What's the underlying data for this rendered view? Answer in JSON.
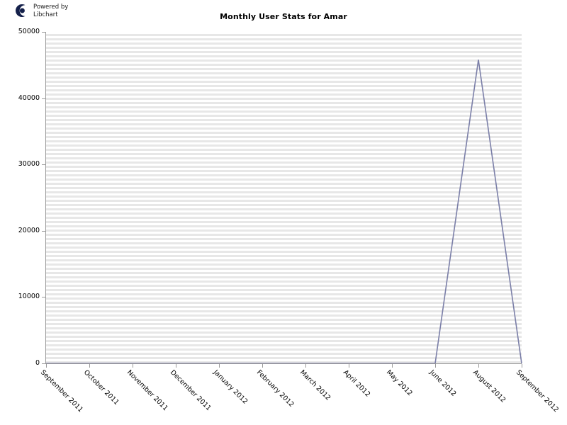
{
  "branding": {
    "logo_icon": "libchart-crescent-logo-icon",
    "line1": "Powered by",
    "line2": "Libchart",
    "logo_color": "#14204a"
  },
  "chart_data": {
    "type": "line",
    "title": "Monthly User Stats for Amar",
    "xlabel": "",
    "ylabel": "",
    "categories": [
      "September 2011",
      "October 2011",
      "November 2011",
      "December 2011",
      "January 2012",
      "February 2012",
      "March 2012",
      "April 2012",
      "May 2012",
      "June 2012",
      "August 2012",
      "September 2012"
    ],
    "values": [
      0,
      0,
      0,
      0,
      0,
      0,
      0,
      0,
      0,
      0,
      45800,
      0
    ],
    "series": [
      {
        "name": "Monthly User Stats for Amar",
        "values": [
          0,
          0,
          0,
          0,
          0,
          0,
          0,
          0,
          0,
          0,
          45800,
          0
        ]
      }
    ],
    "ylim": [
      0,
      50000
    ],
    "yticks": [
      0,
      10000,
      20000,
      30000,
      40000,
      50000
    ],
    "ytick_labels": [
      "0",
      "10000",
      "20000",
      "30000",
      "40000",
      "50000"
    ],
    "grid": "horizontal-stripes",
    "legend": "none",
    "line_color": "#7b7fa8",
    "grid_stripe_color": "#e7e7e7",
    "axis_color": "#9a9a9a",
    "background": "#ffffff"
  }
}
